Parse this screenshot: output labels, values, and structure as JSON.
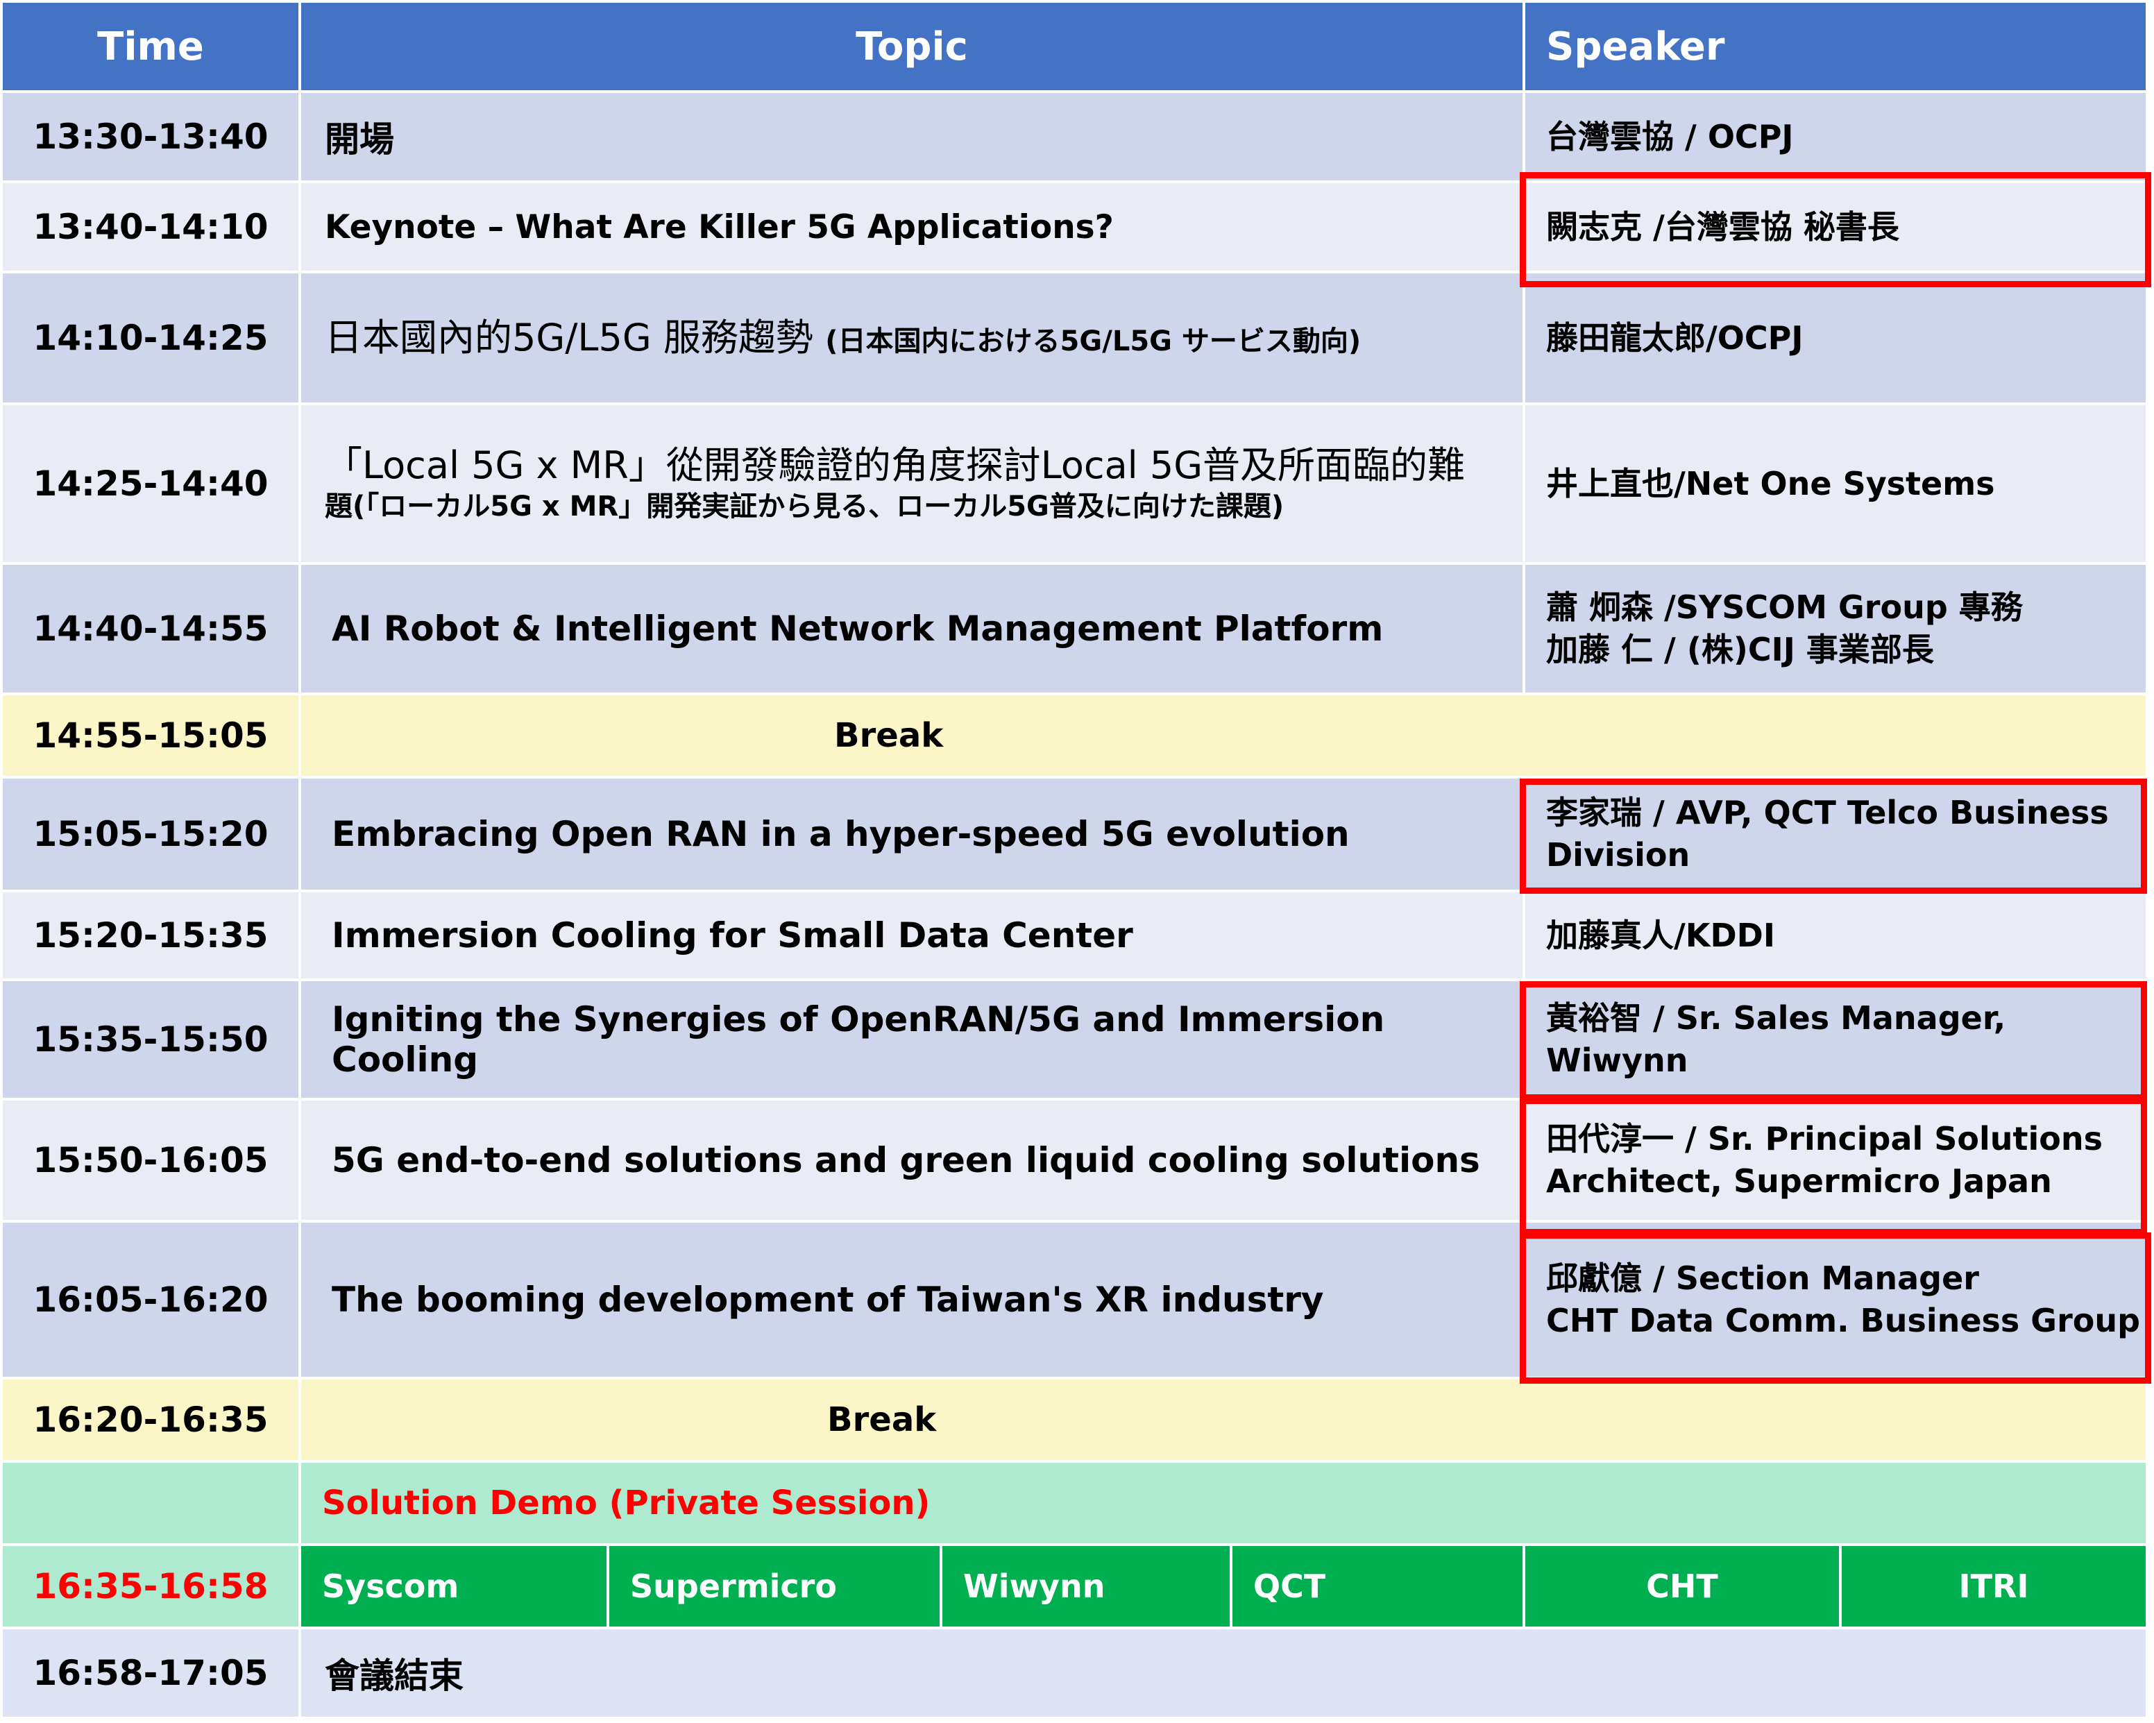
{
  "header": {
    "time": "Time",
    "topic": "Topic",
    "speaker": "Speaker"
  },
  "rows": [
    {
      "time": "13:30-13:40",
      "topic": "開場",
      "speaker": [
        "台灣雲協 / OCPJ"
      ]
    },
    {
      "time": "13:40-14:10",
      "topic": "Keynote – What Are Killer 5G Applications?",
      "speaker": [
        "闕志克 /台灣雲協 秘書長"
      ]
    },
    {
      "time": "14:10-14:25",
      "topic_main": "日本國內的5G/L5G 服務趨勢",
      "topic_sub": "(日本国内における5G/L5G サービス動向)",
      "speaker": [
        "藤田龍太郎/OCPJ"
      ]
    },
    {
      "time": "14:25-14:40",
      "topic_lines": [
        "「Local 5G x MR」從開發驗證的角度探討Local 5G普及所面臨的難",
        "題(「ローカル5G x MR」開発実証から見る、ローカル5G普及に向けた課題)"
      ],
      "speaker": [
        "井上直也/Net One Systems"
      ]
    },
    {
      "time": "14:40-14:55",
      "topic": "AI Robot & Intelligent Network Management Platform",
      "speaker": [
        "蕭 炯森 /SYSCOM Group 專務",
        "加藤 仁 / (株)CIJ 事業部長"
      ]
    },
    {
      "time": "14:55-15:05",
      "break": "Break"
    },
    {
      "time": "15:05-15:20",
      "topic": "Embracing Open RAN in a hyper-speed 5G evolution",
      "speaker": [
        "李家瑞 / AVP, QCT Telco Business",
        "Division"
      ]
    },
    {
      "time": "15:20-15:35",
      "topic": "Immersion Cooling for Small Data Center",
      "speaker": [
        "加藤真人/KDDI"
      ]
    },
    {
      "time": "15:35-15:50",
      "topic": "Igniting the Synergies of OpenRAN/5G and Immersion Cooling",
      "speaker": [
        "黃裕智 / Sr. Sales Manager, Wiwynn"
      ]
    },
    {
      "time": "15:50-16:05",
      "topic": "5G end-to-end solutions and green liquid cooling solutions",
      "speaker": [
        "田代淳一 / Sr. Principal Solutions",
        "Architect, Supermicro Japan"
      ]
    },
    {
      "time": "16:05-16:20",
      "topic": "The booming development of Taiwan's XR industry",
      "speaker": [
        "邱獻億 / Section Manager",
        "CHT Data Comm. Business Group"
      ]
    },
    {
      "time": "16:20-16:35",
      "break": "Break"
    }
  ],
  "demo": {
    "title": "Solution Demo (Private Session)",
    "time": "16:35-16:58",
    "vendors": [
      "Syscom",
      "Supermicro",
      "Wiwynn",
      "QCT",
      "CHT",
      "ITRI"
    ]
  },
  "closing": {
    "time": "16:58-17:05",
    "topic": "會議結束"
  },
  "colors": {
    "header": "#4472c4",
    "row_dark": "#cfd5ea",
    "row_light": "#e9ebf5",
    "break": "#fbf6c8",
    "demo_title_row": "#aeead0",
    "demo_vendor_row": "#00b050",
    "highlight": "#ff0000"
  }
}
